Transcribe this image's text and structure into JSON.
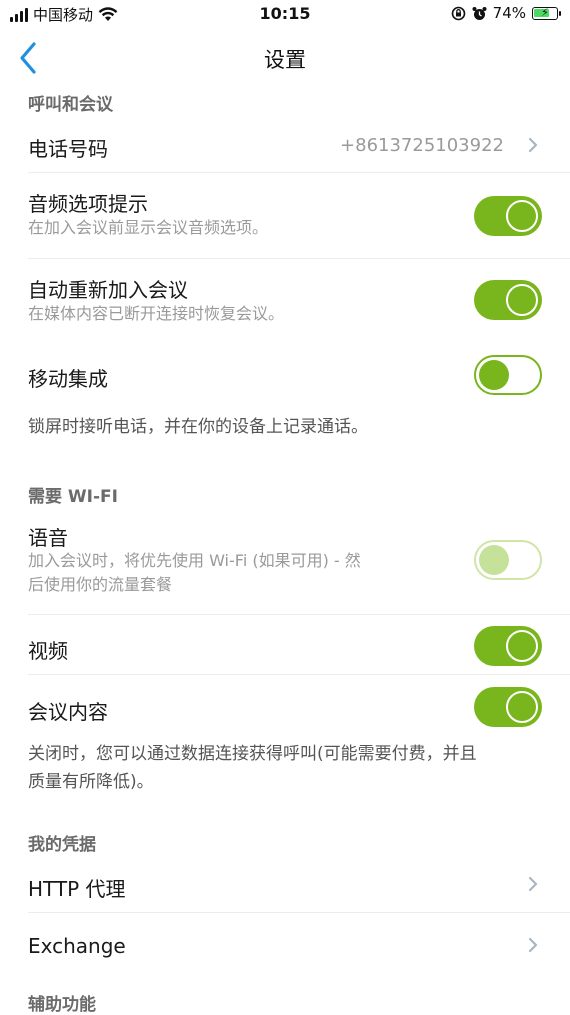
{
  "status_bar": {
    "carrier": "中国移动",
    "time": "10:15",
    "battery": "74%",
    "battery_level": 0.74
  },
  "nav": {
    "title": "设置"
  },
  "sections": {
    "calls": {
      "header": "呼叫和会议"
    },
    "wifi": {
      "header": "需要 WI-FI"
    },
    "credentials": {
      "header": "我的凭据"
    },
    "accessibility": {
      "header": "辅助功能"
    }
  },
  "rows": {
    "phone": {
      "title": "电话号码",
      "value": "+8613725103922"
    },
    "audio_prompt": {
      "title": "音频选项提示",
      "subtitle": "在加入会议前显示会议音频选项。",
      "state": "on"
    },
    "auto_rejoin": {
      "title": "自动重新加入会议",
      "subtitle": "在媒体内容已断开连接时恢复会议。",
      "state": "on"
    },
    "mobile_integration": {
      "title": "移动集成",
      "state": "off"
    },
    "voice": {
      "title": "语音",
      "subtitle_line1": "加入会议时，将优先使用 Wi-Fi (如果可用) - 然",
      "subtitle_line2": "后使用你的流量套餐",
      "state": "disabled"
    },
    "video": {
      "title": "视频",
      "state": "on"
    },
    "meeting_content": {
      "title": "会议内容",
      "state": "on"
    },
    "http_proxy": {
      "title": "HTTP 代理"
    },
    "exchange": {
      "title": "Exchange"
    }
  },
  "notes": {
    "mobile_integration": "锁屏时接听电话，并在你的设备上记录通话。",
    "wifi_line1": "关闭时，您可以通过数据连接获得呼叫(可能需要付费，并且",
    "wifi_line2": "质量有所降低)。"
  },
  "colors": {
    "accent": "#79b51c",
    "back_button": "#1f8fe0"
  },
  "icons": {
    "back": "chevron-left-icon",
    "chevron": "chevron-right-icon",
    "wifi": "wifi-icon",
    "signal": "signal-icon",
    "lock_rotation": "rotation-lock-icon",
    "alarm": "alarm-icon",
    "battery": "battery-icon"
  }
}
